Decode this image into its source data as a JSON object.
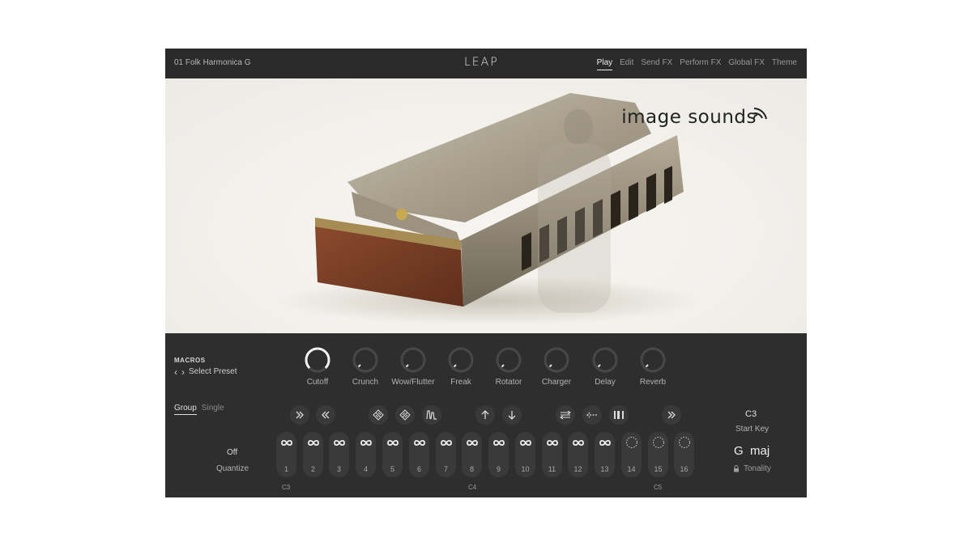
{
  "header": {
    "preset_name": "01 Folk Harmonica G",
    "logo": "LEAP",
    "tabs": [
      {
        "label": "Play",
        "active": true
      },
      {
        "label": "Edit",
        "active": false
      },
      {
        "label": "Send FX",
        "active": false
      },
      {
        "label": "Perform FX",
        "active": false
      },
      {
        "label": "Global FX",
        "active": false
      },
      {
        "label": "Theme",
        "active": false
      }
    ]
  },
  "artwork": {
    "brand": "image sounds"
  },
  "macros": {
    "title": "MACROS",
    "preset_selector": "Select Preset",
    "knobs": [
      {
        "label": "Cutoff",
        "value": 1.0
      },
      {
        "label": "Crunch",
        "value": 0.0
      },
      {
        "label": "Wow/Flutter",
        "value": 0.0
      },
      {
        "label": "Freak",
        "value": 0.0
      },
      {
        "label": "Rotator",
        "value": 0.0
      },
      {
        "label": "Charger",
        "value": 0.0
      },
      {
        "label": "Delay",
        "value": 0.0
      },
      {
        "label": "Reverb",
        "value": 0.0
      }
    ]
  },
  "mode": {
    "tabs": [
      {
        "label": "Group",
        "active": true
      },
      {
        "label": "Single",
        "active": false
      }
    ]
  },
  "quantize": {
    "value": "Off",
    "label": "Quantize"
  },
  "tools": [
    {
      "icon": "double-chevron-right-icon"
    },
    {
      "icon": "double-chevron-left-icon"
    },
    {
      "icon": "randomize-icon"
    },
    {
      "icon": "randomize-alt-icon"
    },
    {
      "icon": "waveform-icon"
    },
    {
      "icon": "arrow-up-icon"
    },
    {
      "icon": "arrow-down-icon"
    },
    {
      "icon": "swap-icon"
    },
    {
      "icon": "reverse-icon"
    },
    {
      "icon": "bars-icon"
    },
    {
      "icon": "double-chevron-right-icon"
    }
  ],
  "slots": [
    {
      "num": "1",
      "loop": true
    },
    {
      "num": "2",
      "loop": true
    },
    {
      "num": "3",
      "loop": true
    },
    {
      "num": "4",
      "loop": true
    },
    {
      "num": "5",
      "loop": true
    },
    {
      "num": "6",
      "loop": true
    },
    {
      "num": "7",
      "loop": true
    },
    {
      "num": "8",
      "loop": true
    },
    {
      "num": "9",
      "loop": true
    },
    {
      "num": "10",
      "loop": true
    },
    {
      "num": "11",
      "loop": true
    },
    {
      "num": "12",
      "loop": true
    },
    {
      "num": "13",
      "loop": true
    },
    {
      "num": "14",
      "loop": false
    },
    {
      "num": "15",
      "loop": false
    },
    {
      "num": "16",
      "loop": false
    }
  ],
  "key_labels": [
    "C3",
    "C4",
    "C5"
  ],
  "start_key": {
    "value": "C3",
    "label": "Start Key"
  },
  "tonality": {
    "key": "G",
    "scale": "maj",
    "label": "Tonality"
  },
  "colors": {
    "panel": "#2e2e2e",
    "header": "#2a2a2a",
    "slot": "#3a3a3a",
    "accent": "#ffffff"
  }
}
